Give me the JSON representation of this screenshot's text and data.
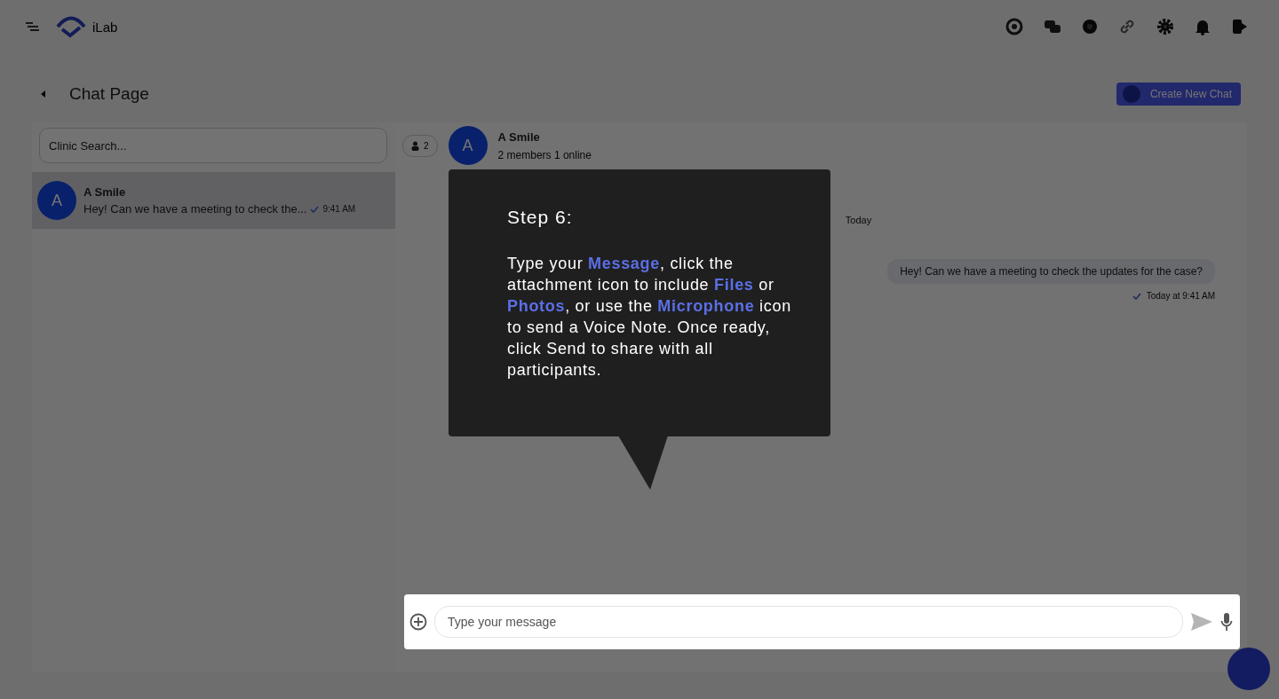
{
  "topbar": {
    "brand": "iLab"
  },
  "header": {
    "title": "Chat Page",
    "create_button": "Create New Chat"
  },
  "sidebar": {
    "search": {
      "placeholder": "Clinic Search..."
    },
    "chats": [
      {
        "avatar": "A",
        "name": "A Smile",
        "preview": "Hey! Can we have a meeting to check the...",
        "time": "9:41 AM",
        "selected": true
      }
    ]
  },
  "chat": {
    "members_badge": "2",
    "avatar": "A",
    "name": "A Smile",
    "status": "2 members 1 online",
    "day_divider": "Today",
    "messages": [
      {
        "text": "Hey! Can we have a meeting to check the updates for the case?",
        "time": "Today at 9:41 AM"
      }
    ],
    "composer": {
      "placeholder": "Type your message"
    }
  },
  "tour": {
    "title": "Step 6:",
    "body": "Type your **Message**, click the attachment icon to include **Files** or **Photos**, or use the **Microphone** icon to send a Voice Note. Once ready, click Send to share with all participants."
  }
}
